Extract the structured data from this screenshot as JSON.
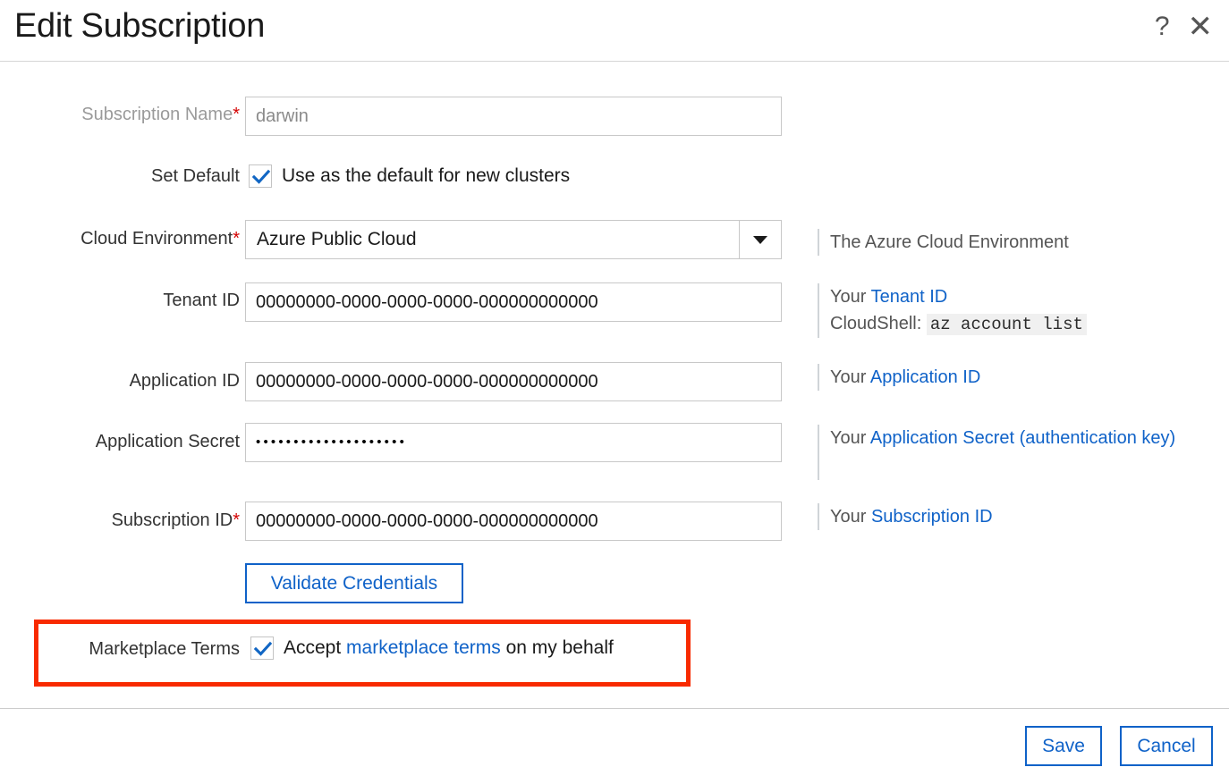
{
  "header": {
    "title": "Edit Subscription",
    "help_icon_label": "?",
    "close_icon_label": "✕"
  },
  "form": {
    "subscription_name": {
      "label": "Subscription Name",
      "required_marker": "*",
      "value": "darwin"
    },
    "set_default": {
      "label": "Set Default",
      "checkbox_label": "Use as the default for new clusters",
      "checked": true
    },
    "cloud_environment": {
      "label": "Cloud Environment",
      "required_marker": "*",
      "value": "Azure Public Cloud",
      "help_text": "The Azure Cloud Environment"
    },
    "tenant_id": {
      "label": "Tenant ID",
      "value": "00000000-0000-0000-0000-000000000000",
      "help_prefix": "Your ",
      "help_link": "Tenant ID",
      "help_line2_prefix": "CloudShell: ",
      "help_line2_code": "az account list"
    },
    "application_id": {
      "label": "Application ID",
      "value": "00000000-0000-0000-0000-000000000000",
      "help_prefix": "Your ",
      "help_link": "Application ID"
    },
    "application_secret": {
      "label": "Application Secret",
      "value": "••••••••••••••••••••",
      "help_prefix": "Your ",
      "help_link": "Application Secret (authentication key)"
    },
    "subscription_id": {
      "label": "Subscription ID",
      "required_marker": "*",
      "value": "00000000-0000-0000-0000-000000000000",
      "help_prefix": "Your ",
      "help_link": "Subscription ID"
    },
    "validate_button": "Validate Credentials",
    "marketplace_terms": {
      "label": "Marketplace Terms",
      "checked": true,
      "text_before": "Accept ",
      "link": "marketplace terms",
      "text_after": " on my behalf"
    }
  },
  "footer": {
    "save_label": "Save",
    "cancel_label": "Cancel"
  },
  "colors": {
    "link_blue": "#0f62c8",
    "required_red": "#d40000",
    "annotation_red": "#f82a00",
    "checkbox_blue": "#1166c4"
  }
}
